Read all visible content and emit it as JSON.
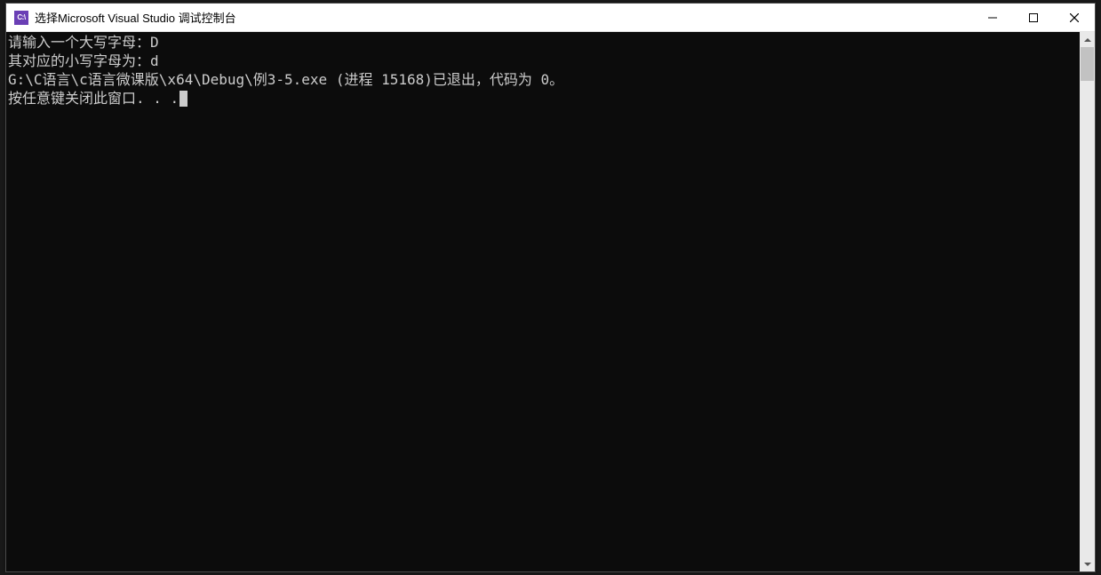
{
  "window": {
    "icon_text": "C:\\",
    "title": "选择Microsoft Visual Studio 调试控制台"
  },
  "console": {
    "line1": "请输入一个大写字母：D",
    "line2": "其对应的小写字母为：d",
    "line3": "G:\\C语言\\c语言微课版\\x64\\Debug\\例3-5.exe (进程 15168)已退出，代码为 0。",
    "line4": "按任意键关闭此窗口. . ."
  }
}
